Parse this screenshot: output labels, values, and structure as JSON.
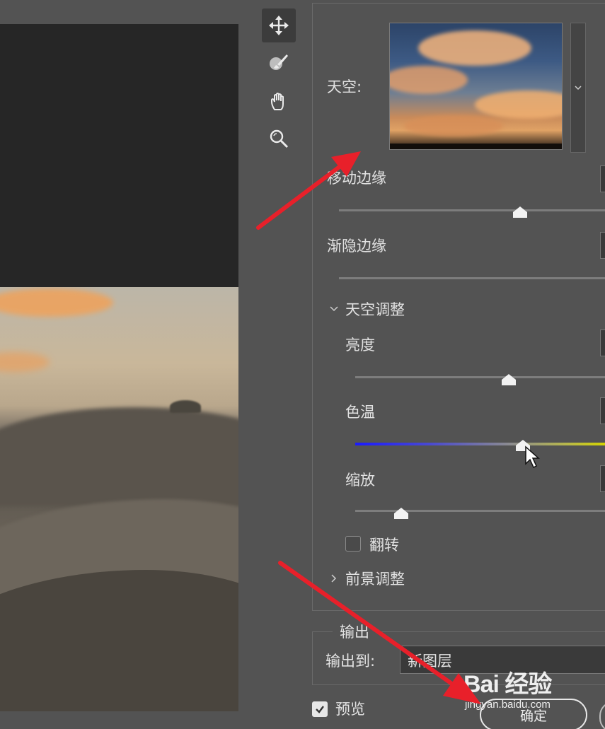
{
  "sky": {
    "label": "天空:"
  },
  "sliders": {
    "shift_edge": {
      "label": "移动边缘",
      "value_fraction": 0.64
    },
    "fade_edge": {
      "label": "渐隐边缘",
      "value_fraction": 0.0
    },
    "brightness": {
      "label": "亮度",
      "value_fraction": 0.62
    },
    "temperature": {
      "label": "色温",
      "value_fraction": 0.67
    },
    "scale": {
      "label": "缩放",
      "value_fraction": 0.18
    }
  },
  "sections": {
    "sky_adjust": "天空调整",
    "foreground_adjust": "前景调整"
  },
  "flip": {
    "label": "翻转",
    "checked": false
  },
  "output": {
    "group_title": "输出",
    "output_to_label": "输出到:",
    "output_to_value": "新图层"
  },
  "preview": {
    "label": "预览",
    "checked": true
  },
  "buttons": {
    "ok": "确定"
  },
  "watermark": {
    "logo": "Bai 经验",
    "url": "jingyan.baidu.com"
  },
  "tools": [
    "move-tool",
    "sky-brush-tool",
    "hand-tool",
    "zoom-tool"
  ],
  "colors": {
    "annotation_arrow": "#e8202a",
    "temperature_cold": "#1a1aff",
    "temperature_warm": "#d4d400"
  }
}
